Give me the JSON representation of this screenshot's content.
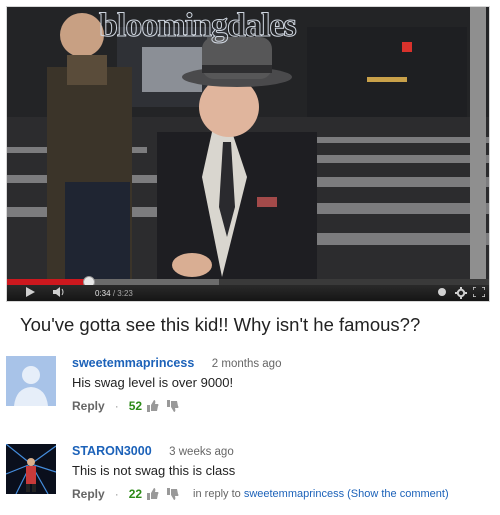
{
  "video": {
    "store_sign": "bloomingdales",
    "current_time": "0:34",
    "time_separator": "/",
    "duration": "3:23",
    "played_fraction": 0.17,
    "title": "You've gotta see this kid!! Why isn't he famous??"
  },
  "icons": {
    "play": "play-icon",
    "volume": "volume-icon",
    "hd": "hd-icon",
    "settings": "gear-icon",
    "fullscreen": "fullscreen-icon"
  },
  "comments": [
    {
      "author": "sweetemmaprincess",
      "time_ago": "2 months ago",
      "text": "His swag level is over 9000!",
      "reply_label": "Reply",
      "likes": "52"
    },
    {
      "author": "STARON3000",
      "time_ago": "3 weeks ago",
      "text": "This is not swag this is class",
      "reply_label": "Reply",
      "likes": "22",
      "in_reply_prefix": "in reply to",
      "in_reply_to": "sweetemmaprincess",
      "show_comment": "(Show the comment)"
    }
  ],
  "colors": {
    "progress_played": "#cc181e",
    "author_link": "#1c62b9",
    "likes": "#2b8a16"
  }
}
